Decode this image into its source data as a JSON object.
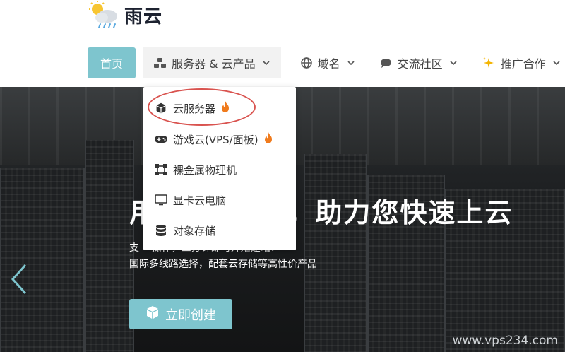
{
  "logo": {
    "text": "雨云",
    "icon": "sun-cloud-rain-icon"
  },
  "nav": {
    "home": "首页",
    "products": "服务器 & 云产品",
    "domain": "域名",
    "community": "交流社区",
    "partner": "推广合作"
  },
  "dropdown": {
    "items": [
      {
        "label": "云服务器",
        "icon": "cube-icon",
        "hot": true
      },
      {
        "label": "游戏云(VPS/面板)",
        "icon": "gamepad-icon",
        "hot": true
      },
      {
        "label": "裸金属物理机",
        "icon": "bare-metal-icon",
        "hot": false
      },
      {
        "label": "显卡云电脑",
        "icon": "monitor-icon",
        "hot": false
      },
      {
        "label": "对象存储",
        "icon": "database-icon",
        "hot": false
      }
    ]
  },
  "hero": {
    "title": "用 ·· 性价比，助力您快速上云",
    "subtitle_line1": "支 ·· 操作，三分钟即可开始建站！",
    "subtitle_line2": "国际多线路选择，配套云存储等高性价产品",
    "cta": "立即创建"
  },
  "watermark": "www.vps234.com",
  "colors": {
    "accent": "#7ec5ce",
    "ring": "#d9534f",
    "flame": "#f07b1d"
  }
}
